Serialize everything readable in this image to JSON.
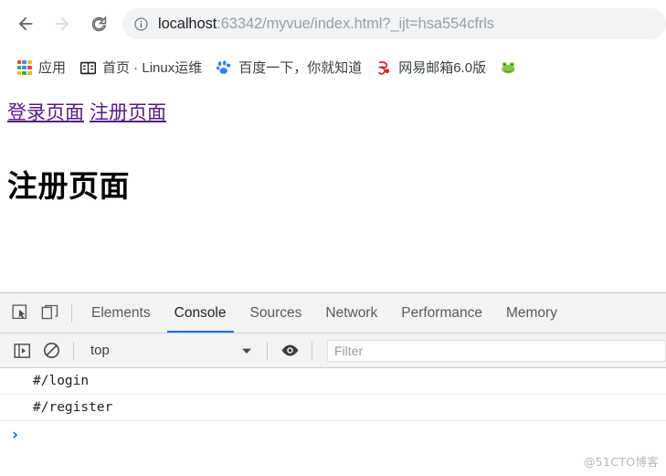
{
  "browser": {
    "nav": {
      "back_label": "Back",
      "forward_label": "Forward",
      "reload_label": "Reload"
    },
    "omnibox": {
      "info_icon": "info-circle-icon",
      "host": "localhost",
      "path": ":63342/myvue/index.html?_ijt=hsa554cfrls",
      "full_url": "localhost:63342/myvue/index.html?_ijt=hsa554cfrls"
    },
    "bookmarks": [
      {
        "label": "应用",
        "icon": "apps-grid-icon"
      },
      {
        "label": "首页 · Linux运维",
        "icon": "book-icon"
      },
      {
        "label": "百度一下，你就知道",
        "icon": "baidu-paw-icon"
      },
      {
        "label": "网易邮箱6.0版",
        "icon": "netease-mail-icon"
      },
      {
        "label": "",
        "icon": "frog-icon"
      }
    ]
  },
  "page": {
    "links": [
      {
        "label": "登录页面"
      },
      {
        "label": "注册页面"
      }
    ],
    "title": "注册页面"
  },
  "devtools": {
    "toolbar_icons": {
      "inspect": "inspect-element-icon",
      "device": "device-toolbar-icon"
    },
    "tabs": [
      {
        "label": "Elements",
        "active": false
      },
      {
        "label": "Console",
        "active": true
      },
      {
        "label": "Sources",
        "active": false
      },
      {
        "label": "Network",
        "active": false
      },
      {
        "label": "Performance",
        "active": false
      },
      {
        "label": "Memory",
        "active": false
      }
    ],
    "console_toolbar": {
      "sidebar_icon": "console-sidebar-icon",
      "clear_icon": "clear-console-icon",
      "context": "top",
      "context_caret": "chevron-down-icon",
      "eye_icon": "live-expression-eye-icon",
      "filter_placeholder": "Filter",
      "filter_value": ""
    },
    "console_messages": [
      "#/login",
      "#/register"
    ],
    "prompt_caret": "›"
  },
  "watermark": "@51CTO博客",
  "colors": {
    "accent_blue": "#1a73e8",
    "visited_link": "#551a8b",
    "omnibox_bg": "#f1f3f4",
    "devtools_bg": "#f3f3f3"
  }
}
